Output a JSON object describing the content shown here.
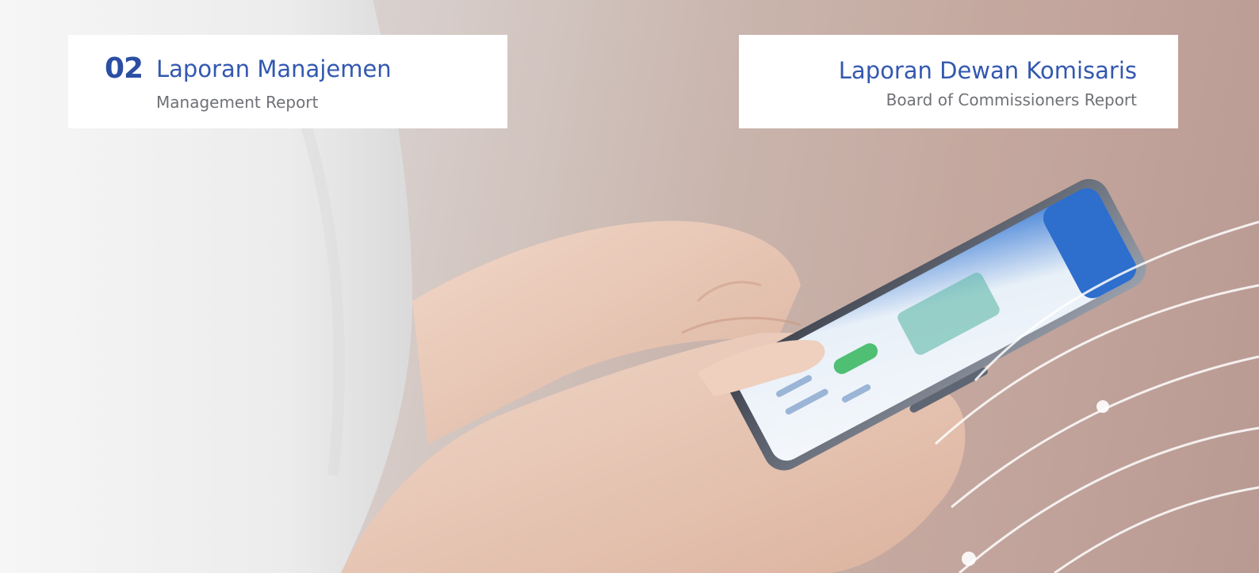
{
  "left_card": {
    "section_number": "02",
    "title": "Laporan Manajemen",
    "subtitle": "Management Report"
  },
  "right_card": {
    "title": "Laporan Dewan Komisaris",
    "subtitle": "Board of Commissioners Report"
  },
  "colors": {
    "accent": "#3358b0",
    "section_number": "#2c4ea3",
    "subtitle": "#6f7177",
    "card": "#ffffff"
  }
}
